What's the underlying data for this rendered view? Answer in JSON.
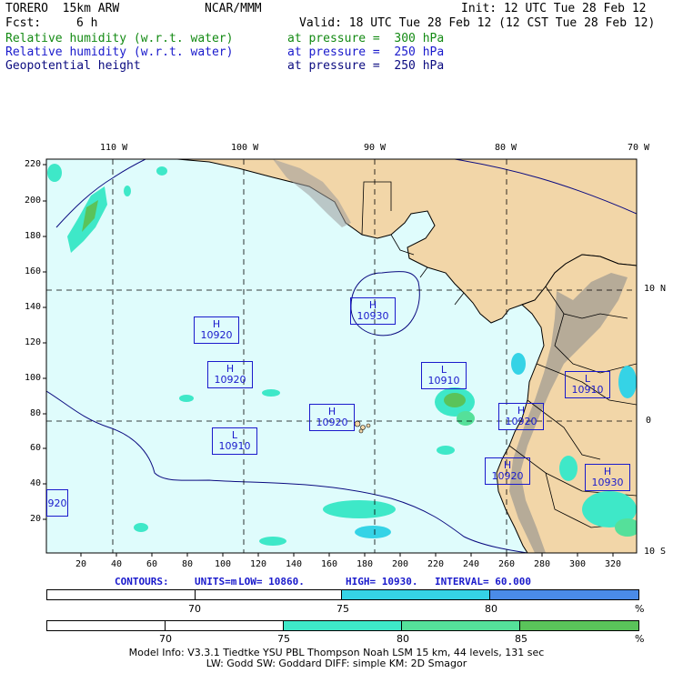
{
  "header": {
    "model": "TORERO  15km ARW",
    "org": "NCAR/MMM",
    "init": "Init: 12 UTC Tue 28 Feb 12",
    "fcst_label": "Fcst:",
    "fcst_value": "6 h",
    "valid": "Valid: 18 UTC Tue 28 Feb 12 (12 CST Tue 28 Feb 12)",
    "fields": [
      {
        "name": "Relative humidity (w.r.t. water)",
        "level": "at pressure =  300 hPa",
        "color": "#138a13"
      },
      {
        "name": "Relative humidity (w.r.t. water)",
        "level": "at pressure =  250 hPa",
        "color": "#1a1acc"
      },
      {
        "name": "Geopotential height",
        "level": "at pressure =  250 hPa",
        "color": "#0b0b80"
      }
    ]
  },
  "axes": {
    "top_lon": [
      "110 W",
      "100 W",
      "90 W",
      "80 W",
      "70 W"
    ],
    "right_lat": [
      "10 N",
      "0",
      "10 S"
    ],
    "left_y": [
      "220",
      "200",
      "180",
      "160",
      "140",
      "120",
      "100",
      "80",
      "60",
      "40",
      "20"
    ],
    "bottom_x": [
      "20",
      "40",
      "60",
      "80",
      "100",
      "120",
      "140",
      "160",
      "180",
      "200",
      "220",
      "240",
      "260",
      "280",
      "300",
      "320"
    ]
  },
  "centers": [
    {
      "kind": "H",
      "value": "10930"
    },
    {
      "kind": "H",
      "value": "10920"
    },
    {
      "kind": "H",
      "value": "10920"
    },
    {
      "kind": "L",
      "value": "10910"
    },
    {
      "kind": "H",
      "value": "10920"
    },
    {
      "kind": "L",
      "value": "10910"
    },
    {
      "kind": "H",
      "value": "10920"
    },
    {
      "kind": "L",
      "value": "10910"
    },
    {
      "kind": "H",
      "value": "10920"
    },
    {
      "kind": "H",
      "value": "10930"
    },
    {
      "kind": "",
      "value": "920"
    }
  ],
  "contours": {
    "label": "CONTOURS:",
    "units": "UNITS=m",
    "low": "LOW=  10860.",
    "high": "HIGH=  10930.",
    "interval": "INTERVAL=   60.000"
  },
  "legend_250": {
    "ticks": [
      "70",
      "75",
      "80"
    ],
    "unit": "%",
    "colors": [
      "#ffffff",
      "#ffffff",
      "#35d3e6",
      "#4a8be8"
    ]
  },
  "legend_300": {
    "ticks": [
      "70",
      "75",
      "80",
      "85"
    ],
    "unit": "%",
    "colors": [
      "#ffffff",
      "#ffffff",
      "#3ee8c8",
      "#55e09a",
      "#5ac35a"
    ]
  },
  "footer": {
    "line1": "Model Info: V3.3.1   Tiedtke YSU PBL  Thompson   Noah LSM  15 km,   44 levels,  131 sec",
    "line2": "LW: Godd SW: Goddard DIFF: simple KM: 2D Smagor"
  }
}
